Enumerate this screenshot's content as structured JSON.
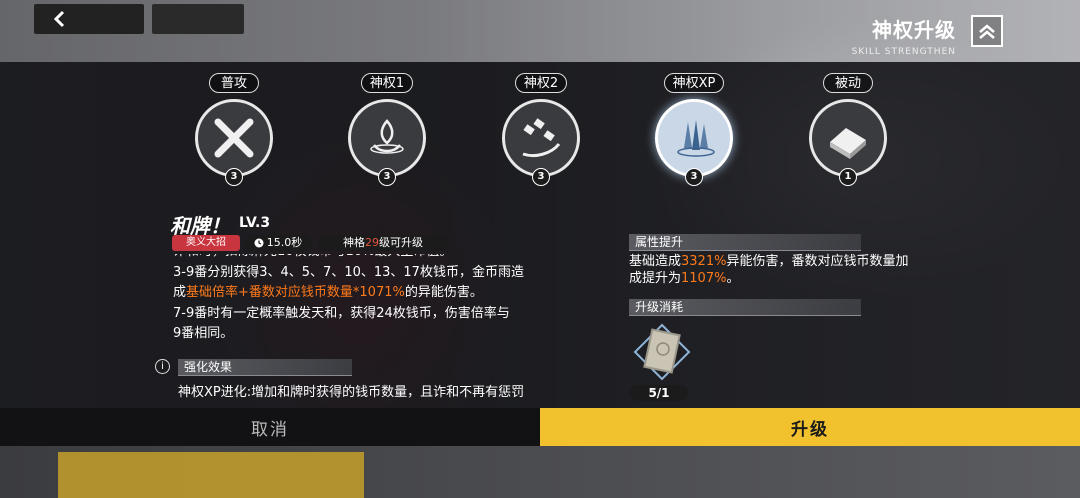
{
  "header": {
    "title": "神权升级",
    "subtitle": "SKILL STRENGTHEN"
  },
  "skills": [
    {
      "label": "普攻",
      "level": "3"
    },
    {
      "label": "神权1",
      "level": "3"
    },
    {
      "label": "神权2",
      "level": "3"
    },
    {
      "label": "神权XP",
      "level": "3",
      "selected": true
    },
    {
      "label": "被动",
      "level": "1"
    }
  ],
  "skill_detail": {
    "name": "和牌！",
    "lv": "LV.3",
    "tag_type": "奥义大招",
    "cooldown": "15.0秒",
    "req_prefix": "神格",
    "req_num": "29",
    "req_suffix": "级可升级",
    "desc": {
      "line0": "诈和时，扣除麻光10枚钱币与10%最大生命值。",
      "line1": "3-9番分别获得3、4、5、7、10、13、17枚钱币，金币雨造",
      "line2_a": "成",
      "line2_hl": "基础倍率+番数对应钱币数量*1071%",
      "line2_b": "的异能伤害。",
      "line3": "7-9番时有一定概率触发天和，获得24枚钱币，伤害倍率与",
      "line4": "9番相同。"
    },
    "enhance_heading": "强化效果",
    "enhance_text": "神权XP进化:增加和牌时获得的钱币数量，且诈和不再有惩罚"
  },
  "attributes": {
    "heading": "属性提升",
    "l1_a": "基础造成",
    "l1_hl": "3321%",
    "l1_b": "异能伤害，番数对应钱币数量加",
    "l2_a": "成提升为",
    "l2_hl": "1107%",
    "l2_b": "。"
  },
  "cost": {
    "heading": "升级消耗",
    "count": "5/1"
  },
  "actions": {
    "cancel": "取消",
    "upgrade": "升级"
  },
  "colors": {
    "accent": "#f2c12e",
    "highlight": "#ff7a1a",
    "tag_red": "#c9353f"
  }
}
